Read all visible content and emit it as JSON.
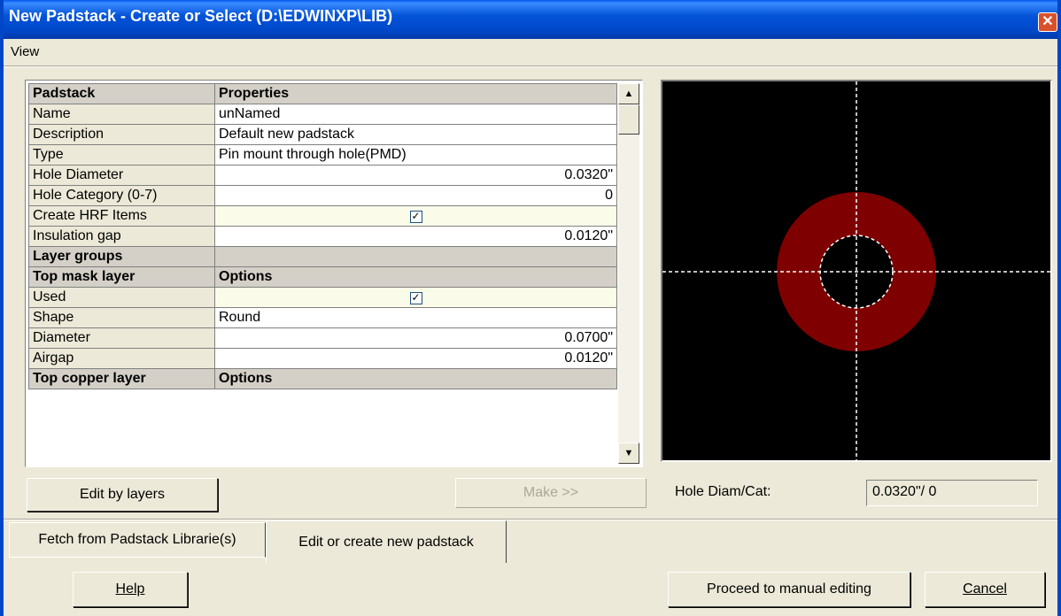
{
  "window": {
    "title": "New Padstack - Create or Select (D:\\EDWINXP\\LIB)",
    "close_glyph": "✕"
  },
  "menu": {
    "view": "View"
  },
  "grid": {
    "rows": [
      {
        "label": "Padstack",
        "value": "Properties",
        "kind": "header"
      },
      {
        "label": "Name",
        "value": "unNamed",
        "kind": "text"
      },
      {
        "label": "Description",
        "value": "Default new padstack",
        "kind": "text"
      },
      {
        "label": "Type",
        "value": "Pin mount through hole(PMD)",
        "kind": "text"
      },
      {
        "label": "Hole Diameter",
        "value": "0.0320\"",
        "kind": "num"
      },
      {
        "label": "Hole Category (0-7)",
        "value": "0",
        "kind": "num"
      },
      {
        "label": "Create HRF Items",
        "value": "☑",
        "kind": "check"
      },
      {
        "label": "Insulation gap",
        "value": "0.0120\"",
        "kind": "num"
      },
      {
        "label": "Layer groups",
        "value": "",
        "kind": "header"
      },
      {
        "label": "Top mask layer",
        "value": "Options",
        "kind": "header"
      },
      {
        "label": "Used",
        "value": "☑",
        "kind": "check"
      },
      {
        "label": "Shape",
        "value": "Round",
        "kind": "text"
      },
      {
        "label": "Diameter",
        "value": "0.0700\"",
        "kind": "num"
      },
      {
        "label": "Airgap",
        "value": "0.0120\"",
        "kind": "num"
      },
      {
        "label": "Top copper layer",
        "value": "Options",
        "kind": "header"
      }
    ]
  },
  "scrollbar": {
    "up": "▲",
    "down": "▼"
  },
  "preview": {
    "pad_color": "#7f0000",
    "bg_color": "#000000"
  },
  "buttons": {
    "edit_by_layers": "Edit by layers",
    "make": "Make >>",
    "help": "Help",
    "proceed": "Proceed to manual editing",
    "cancel": "Cancel"
  },
  "hole_diam_cat": {
    "label": "Hole Diam/Cat:",
    "value": "0.0320\"/ 0"
  },
  "tabs": [
    {
      "label": "Fetch from Padstack Librarie(s)"
    },
    {
      "label": "Edit or create new padstack"
    }
  ]
}
